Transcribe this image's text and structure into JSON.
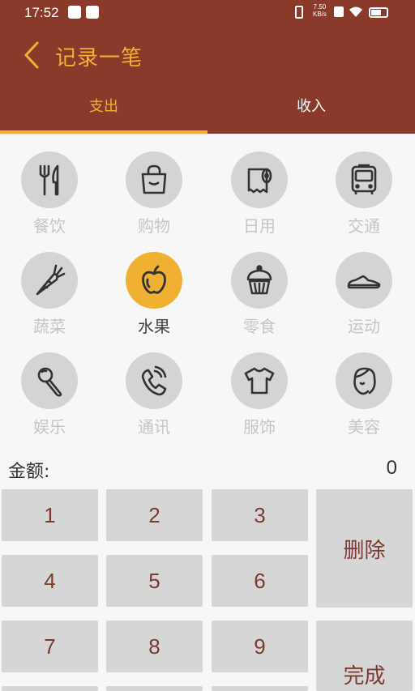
{
  "status": {
    "time": "17:52",
    "net_speed": "7.50",
    "net_unit": "KB/s"
  },
  "header": {
    "title": "记录一笔"
  },
  "tabs": [
    {
      "label": "支出"
    },
    {
      "label": "收入"
    }
  ],
  "categories": [
    {
      "label": "餐饮",
      "icon": "utensils-icon"
    },
    {
      "label": "购物",
      "icon": "shopping-bag-icon"
    },
    {
      "label": "日用",
      "icon": "paper-roll-icon"
    },
    {
      "label": "交通",
      "icon": "bus-icon"
    },
    {
      "label": "蔬菜",
      "icon": "carrot-icon"
    },
    {
      "label": "水果",
      "icon": "apple-icon"
    },
    {
      "label": "零食",
      "icon": "cupcake-icon"
    },
    {
      "label": "运动",
      "icon": "sneaker-icon"
    },
    {
      "label": "娱乐",
      "icon": "microphone-icon"
    },
    {
      "label": "通讯",
      "icon": "phone-icon"
    },
    {
      "label": "服饰",
      "icon": "tshirt-icon"
    },
    {
      "label": "美容",
      "icon": "face-icon"
    }
  ],
  "selected_category": "水果",
  "amount": {
    "label": "金额:",
    "value": "0"
  },
  "keypad": {
    "k1": "1",
    "k2": "2",
    "k3": "3",
    "k4": "4",
    "k5": "5",
    "k6": "6",
    "k7": "7",
    "k8": "8",
    "k9": "9",
    "delete": "删除",
    "done": "完成"
  },
  "colors": {
    "header_bg": "#8a3a2a",
    "accent": "#f2b136",
    "key_text": "#7a3a30"
  }
}
